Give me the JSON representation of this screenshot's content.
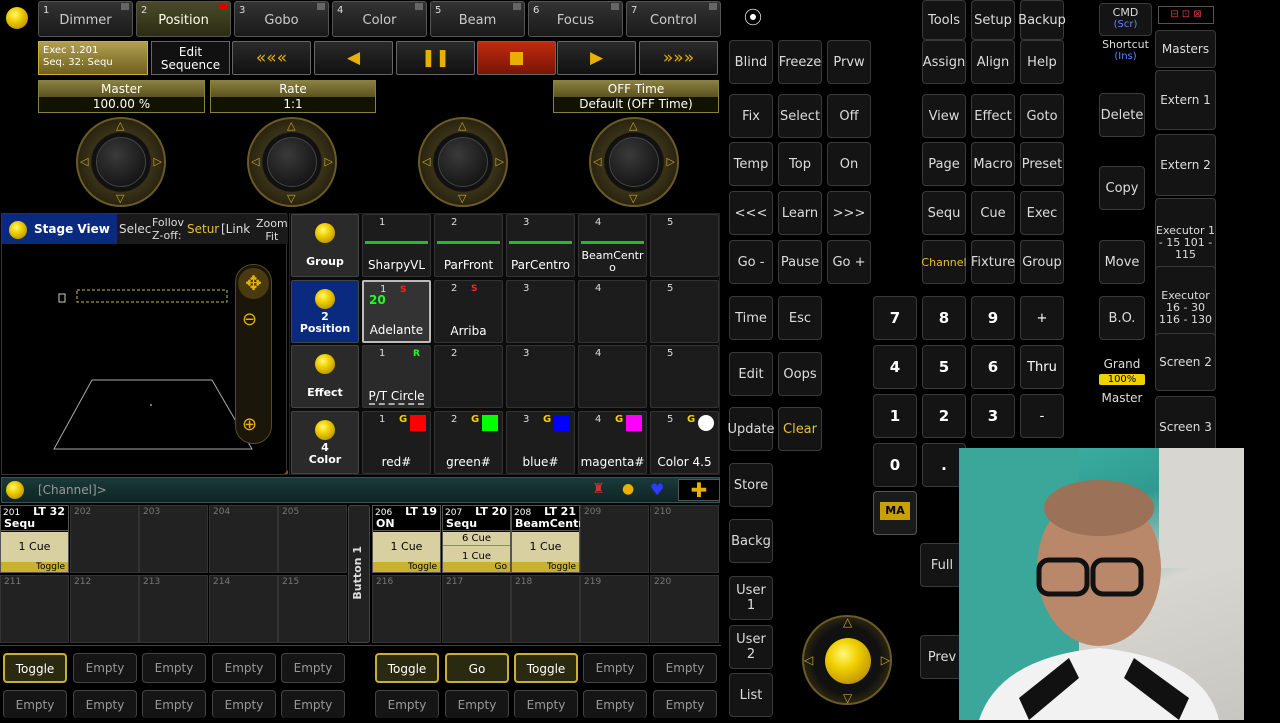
{
  "tabs": [
    {
      "n": "1",
      "label": "Dimmer"
    },
    {
      "n": "2",
      "label": "Position"
    },
    {
      "n": "3",
      "label": "Gobo"
    },
    {
      "n": "4",
      "label": "Color"
    },
    {
      "n": "5",
      "label": "Beam"
    },
    {
      "n": "6",
      "label": "Focus"
    },
    {
      "n": "7",
      "label": "Control"
    }
  ],
  "exec_info": {
    "line1": "Exec 1.201",
    "line2": "Seq. 32: Sequ"
  },
  "edit_seq": {
    "line1": "Edit",
    "line2": "Sequence"
  },
  "playback": {
    "rew": "«««",
    "back": "◀",
    "pause": "❚❚",
    "stop": "■",
    "go": "▶",
    "ff": "»»»"
  },
  "master": {
    "label": "Master",
    "value": "100.00 %"
  },
  "rate": {
    "label": "Rate",
    "value": "1:1"
  },
  "offtime": {
    "label": "OFF Time",
    "value": "Default (OFF Time)"
  },
  "stageview": {
    "title": "Stage View",
    "select": "Selec",
    "follow1": "Follov",
    "follow2": "Z-off:",
    "setup": "Setur",
    "link": "[Link",
    "zoom1": "Zoom",
    "zoom2": "Fit"
  },
  "pool_rows": [
    {
      "label": "Group",
      "num": ""
    },
    {
      "label": "Position",
      "num": "2"
    },
    {
      "label": "Effect",
      "num": ""
    },
    {
      "label": "Color",
      "num": "4"
    }
  ],
  "groups": [
    {
      "n": "1",
      "l": "SharpyVL"
    },
    {
      "n": "2",
      "l": "ParFront"
    },
    {
      "n": "3",
      "l": "ParCentro"
    },
    {
      "n": "4",
      "l": "BeamCentro"
    },
    {
      "n": "5",
      "l": ""
    }
  ],
  "positions": [
    {
      "n": "1",
      "l": "Adelante",
      "badge": "20",
      "mark": "S"
    },
    {
      "n": "2",
      "l": "Arriba",
      "mark": "S"
    },
    {
      "n": "3",
      "l": ""
    },
    {
      "n": "4",
      "l": ""
    },
    {
      "n": "5",
      "l": ""
    }
  ],
  "effects": [
    {
      "n": "1",
      "l": "P/T Circle"
    },
    {
      "n": "2",
      "l": ""
    },
    {
      "n": "3",
      "l": ""
    },
    {
      "n": "4",
      "l": ""
    },
    {
      "n": "5",
      "l": ""
    }
  ],
  "colors": [
    {
      "n": "1",
      "l": "red#",
      "c": "#ff0000"
    },
    {
      "n": "2",
      "l": "green#",
      "c": "#00ff00"
    },
    {
      "n": "3",
      "l": "blue#",
      "c": "#0000ff"
    },
    {
      "n": "4",
      "l": "magenta#",
      "c": "#ff00ff"
    },
    {
      "n": "5",
      "l": "Color 4.5",
      "c": "#ffffff"
    }
  ],
  "cmdline": {
    "text": "[Channel]>"
  },
  "exec_row1": [
    {
      "n": "201",
      "title": "LT 32",
      "sub": "Sequ",
      "cue": "1 Cue",
      "btn": "Toggle",
      "active": true
    },
    {
      "n": "202"
    },
    {
      "n": "203"
    },
    {
      "n": "204"
    },
    {
      "n": "205"
    },
    {
      "n": "206",
      "title": "LT 19",
      "sub": "ON",
      "cue": "1 Cue",
      "btn": "Toggle",
      "active": true
    },
    {
      "n": "207",
      "title": "LT 20",
      "sub": "Sequ",
      "cue": "6 Cue",
      "cue2": "1 Cue",
      "btn": "Go",
      "active": true
    },
    {
      "n": "208",
      "title": "LT 21",
      "sub": "BeamCentr",
      "cue": "1 Cue",
      "btn": "Toggle",
      "active": true
    },
    {
      "n": "209"
    },
    {
      "n": "210"
    }
  ],
  "exec_row2": [
    "211",
    "212",
    "213",
    "214",
    "215",
    "216",
    "217",
    "218",
    "219",
    "220"
  ],
  "button_label": "Button 1",
  "bottom_row1": [
    "Toggle",
    "Empty",
    "Empty",
    "Empty",
    "Empty",
    "Toggle",
    "Go",
    "Toggle",
    "Empty",
    "Empty"
  ],
  "bottom_row2": [
    "Empty",
    "Empty",
    "Empty",
    "Empty",
    "Empty",
    "Empty",
    "Empty",
    "Empty",
    "Empty",
    "Empty"
  ],
  "keys_col1": [
    "Blind",
    "Fix",
    "Temp",
    "<<<",
    "Go -",
    "Time",
    "Edit",
    "Update",
    "Store",
    "Backg",
    "User 1",
    "User 2",
    "List"
  ],
  "keys_col2": [
    "Freeze",
    "Select",
    "Top",
    "Learn",
    "Pause",
    "Esc",
    "Oops",
    "Clear"
  ],
  "keys_col3": [
    "Prvw",
    "Off",
    "On",
    ">>>",
    "Go +"
  ],
  "keys_right": {
    "tools": "Tools",
    "setup": "Setup",
    "backup": "Backup",
    "assign": "Assign",
    "align": "Align",
    "help": "Help",
    "view": "View",
    "effect": "Effect",
    "goto": "Goto",
    "page": "Page",
    "macro": "Macro",
    "preset": "Preset",
    "sequ": "Sequ",
    "cue": "Cue",
    "exec": "Exec",
    "channel": "Channel",
    "fixture": "Fixture",
    "group": "Group"
  },
  "numpad": [
    "7",
    "8",
    "9",
    "+",
    "4",
    "5",
    "6",
    "Thru",
    "1",
    "2",
    "3",
    "-",
    "0",
    "."
  ],
  "side_keys": {
    "cmd": "CMD",
    "scr": "(Scr)",
    "shortcut": "Shortcut",
    "ins": "(Ins)",
    "delete": "Delete",
    "copy": "Copy",
    "move": "Move",
    "bo": "B.O.",
    "grand": "Grand",
    "pct": "100%",
    "master": "Master",
    "full": "Full",
    "prev": "Prev",
    "ma": "MA"
  },
  "far_right": [
    "Masters",
    "Extern 1",
    "Extern 2",
    "Executor 1 - 15 101 - 115",
    "Executor 16 - 30 116 - 130",
    "Screen 2",
    "Screen 3"
  ]
}
